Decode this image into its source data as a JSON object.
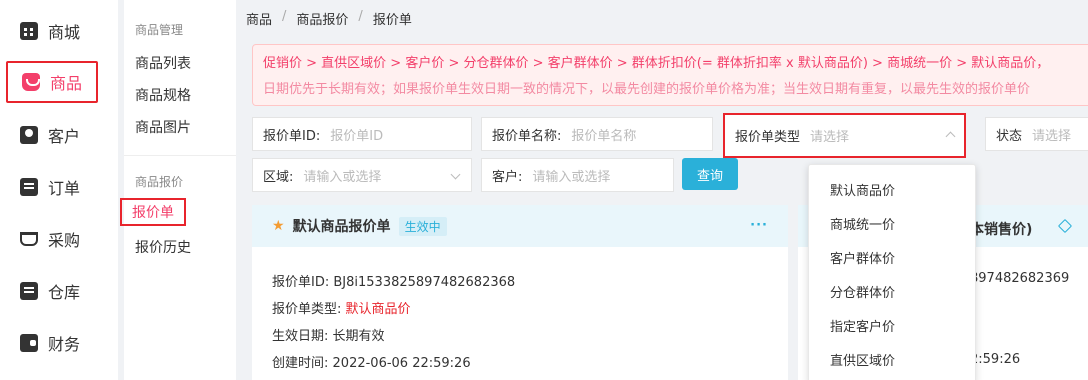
{
  "nav": {
    "items": [
      {
        "label": "商城",
        "icon": "shop-icon"
      },
      {
        "label": "商品",
        "icon": "bag-icon"
      },
      {
        "label": "客户",
        "icon": "person-icon"
      },
      {
        "label": "订单",
        "icon": "document-icon"
      },
      {
        "label": "采购",
        "icon": "cart-icon"
      },
      {
        "label": "仓库",
        "icon": "warehouse-icon"
      },
      {
        "label": "财务",
        "icon": "wallet-icon"
      }
    ],
    "active_color": "#f33f6a"
  },
  "subnav": {
    "group1": "商品管理",
    "group1_items": [
      "商品列表",
      "商品规格",
      "商品图片"
    ],
    "group2": "商品报价",
    "group2_items": [
      "报价单",
      "报价历史"
    ]
  },
  "breadcrumb": [
    "商品",
    "商品报价",
    "报价单"
  ],
  "notice": {
    "line1": "促销价 > 直供区域价 > 客户价 > 分仓群体价 > 客户群体价 > 群体折扣价(= 群体折扣率 x 默认商品价) > 商城统一价 > 默认商品价，",
    "line2": "日期优先于长期有效；如果报价单生效日期一致的情况下，以最先创建的报价单价格为准；当生效日期有重复，以最先生效的报价单价"
  },
  "filters": {
    "id_label": "报价单ID:",
    "id_placeholder": "报价单ID",
    "name_label": "报价单名称:",
    "name_placeholder": "报价单名称",
    "type_label": "报价单类型",
    "type_placeholder": "请选择",
    "status_label": "状态",
    "status_placeholder": "请选择",
    "region_label": "区域:",
    "region_placeholder": "请输入或选择",
    "customer_label": "客户:",
    "customer_placeholder": "请输入或选择",
    "query_label": "查询"
  },
  "card1": {
    "title": "默认商品报价单",
    "badge": "生效中",
    "more": "···",
    "id_label": "报价单ID:",
    "id_value": "BJ8i1533825897482682368",
    "type_label": "报价单类型:",
    "type_value": "默认商品价",
    "date_label": "生效日期:",
    "date_value": "长期有效",
    "created_label": "创建时间:",
    "created_value": "2022-06-06 22:59:26"
  },
  "card2": {
    "title_fragment": "本销售价)",
    "id_fragment": "897482682369",
    "time_fragment": "2:59:26"
  },
  "dropdown": {
    "options": [
      "默认商品价",
      "商城统一价",
      "客户群体价",
      "分仓群体价",
      "指定客户价",
      "直供区域价"
    ]
  },
  "colors": {
    "accent": "#2ab0d9",
    "danger": "#e8242c",
    "pink": "#f33f6a",
    "star": "#f39c33"
  }
}
